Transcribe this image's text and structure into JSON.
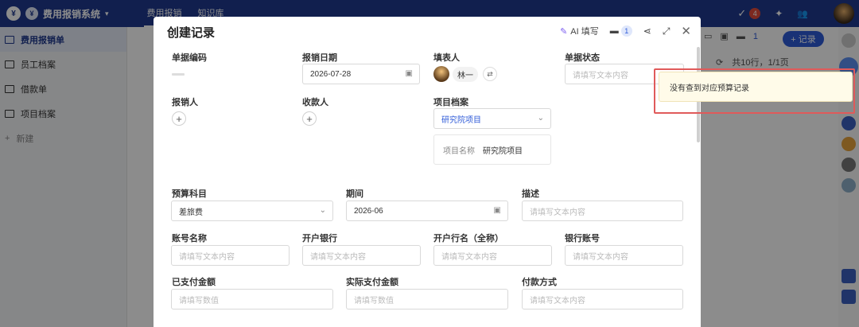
{
  "app": {
    "logo_glyph": "¥",
    "title": "费用报销系统",
    "nav_tabs": [
      "费用报销",
      "知识库"
    ],
    "notification_count": "4"
  },
  "sidebar": {
    "items": [
      {
        "label": "费用报销单",
        "active": true
      },
      {
        "label": "员工档案",
        "active": false
      },
      {
        "label": "借款单",
        "active": false
      },
      {
        "label": "项目档案",
        "active": false
      }
    ],
    "add_label": "新建"
  },
  "background": {
    "add_button": "+ 记录",
    "toolbar_count": "1",
    "pager": "共10行，1/1页"
  },
  "modal": {
    "title": "创建记录",
    "ai_fill_label": "AI 填写",
    "inbox_count": "1",
    "fields": {
      "doc_no": {
        "label": "单据编码"
      },
      "report_date": {
        "label": "报销日期",
        "value": "2026-07-28"
      },
      "filler": {
        "label": "填表人",
        "user": "林一"
      },
      "doc_status": {
        "label": "单据状态",
        "placeholder": "请填写文本内容"
      },
      "reporter": {
        "label": "报销人"
      },
      "payee": {
        "label": "收款人"
      },
      "project": {
        "label": "项目档案",
        "value": "研究院项目",
        "card_key": "项目名称",
        "card_value": "研究院项目"
      },
      "budget_subject": {
        "label": "预算科目",
        "value": "差旅费"
      },
      "period": {
        "label": "期间",
        "value": "2026-06"
      },
      "description": {
        "label": "描述",
        "placeholder": "请填写文本内容"
      },
      "account_name": {
        "label": "账号名称",
        "placeholder": "请填写文本内容"
      },
      "bank": {
        "label": "开户银行",
        "placeholder": "请填写文本内容"
      },
      "bank_full_name": {
        "label": "开户行名（全称）",
        "placeholder": "请填写文本内容"
      },
      "bank_account": {
        "label": "银行账号",
        "placeholder": "请填写文本内容"
      },
      "paid_amount": {
        "label": "已支付金额",
        "placeholder": "请填写数值"
      },
      "actual_paid_amount": {
        "label": "实际支付金额",
        "placeholder": "请填写数值"
      },
      "payment_method": {
        "label": "付款方式",
        "placeholder": "请填写文本内容"
      }
    }
  },
  "toast": {
    "message": "没有查到对应预算记录"
  },
  "colors": {
    "brand": "#1f3a8f",
    "accent": "#2f5bd8",
    "highlight_border": "#e05a5a",
    "toast_bg": "#fffbe9"
  }
}
